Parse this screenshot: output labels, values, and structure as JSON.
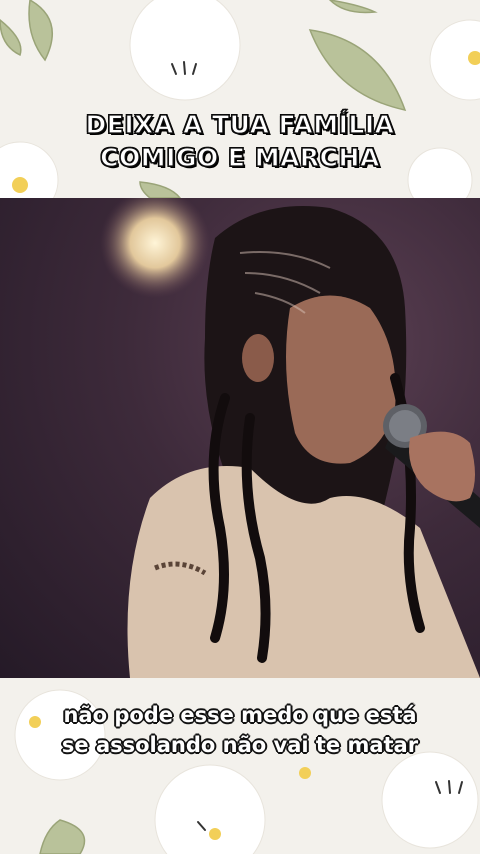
{
  "overlay": {
    "headline_lines": [
      "DEIXA A TUA FAMÍLIA",
      "COMIGO E MARCHA"
    ]
  },
  "captions": {
    "lines": [
      "não pode esse medo que está",
      "se assolando não vai te matar"
    ]
  },
  "theme": {
    "background": "#f3f1ec",
    "leaf": "#b9c29a",
    "flower_center": "#f2cf58"
  }
}
